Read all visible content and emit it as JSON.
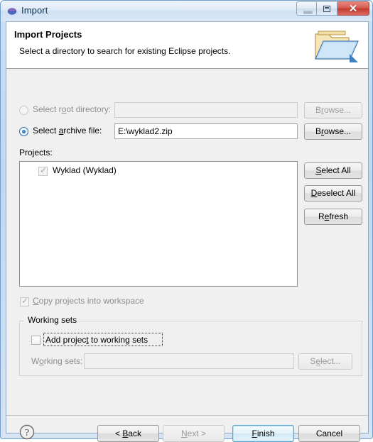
{
  "window": {
    "title": "Import",
    "icon": "eclipse-sphere-icon",
    "controls": {
      "minimize": "minimize-icon",
      "maximize": "restore-icon",
      "close": "close-icon",
      "close_glyph": "✕"
    }
  },
  "header": {
    "title": "Import Projects",
    "subtitle": "Select a directory to search for existing Eclipse projects.",
    "icon": "open-folder-icon"
  },
  "source": {
    "root_directory": {
      "label_pre": "Select r",
      "label_mnemonic": "o",
      "label_post": "ot directory:",
      "selected": false,
      "enabled": false,
      "value": "",
      "browse_label_pre": "B",
      "browse_mnemonic": "r",
      "browse_label_post": "owse...",
      "browse_enabled": false
    },
    "archive_file": {
      "label_pre": "Select ",
      "label_mnemonic": "a",
      "label_post": "rchive file:",
      "selected": true,
      "enabled": true,
      "value": "E:\\wyklad2.zip",
      "browse_label_pre": "B",
      "browse_mnemonic": "r",
      "browse_label_post": "owse...",
      "browse_enabled": true
    }
  },
  "projects": {
    "label": "Projects:",
    "items": [
      {
        "label": "Wyklad (Wyklad)",
        "checked": true
      }
    ],
    "buttons": {
      "select_all": {
        "pre": "",
        "mnemonic": "S",
        "post": "elect All"
      },
      "deselect_all": {
        "pre": "",
        "mnemonic": "D",
        "post": "eselect All"
      },
      "refresh": {
        "pre": "R",
        "mnemonic": "e",
        "post": "fresh"
      }
    }
  },
  "options": {
    "copy_projects": {
      "pre": "",
      "mnemonic": "C",
      "post": "opy projects into workspace",
      "checked": true,
      "enabled": false
    }
  },
  "working_sets": {
    "group_title": "Working sets",
    "add_checkbox": {
      "pre": "Add projec",
      "mnemonic": "t",
      "post": " to working sets",
      "checked": false,
      "focused": true
    },
    "combo_label_pre": "W",
    "combo_label_mnemonic": "o",
    "combo_label_post": "rking sets:",
    "combo_value": "",
    "combo_enabled": false,
    "select_button": {
      "pre": "S",
      "mnemonic": "e",
      "post": "lect...",
      "enabled": false
    }
  },
  "footer": {
    "help_icon": "help-question-icon",
    "back": {
      "pre": "< ",
      "mnemonic": "B",
      "post": "ack",
      "enabled": true
    },
    "next": {
      "pre": "",
      "mnemonic": "N",
      "post": "ext >",
      "enabled": false
    },
    "finish": {
      "pre": "",
      "mnemonic": "F",
      "post": "inish",
      "enabled": true,
      "default": true
    },
    "cancel": {
      "pre": "Cancel",
      "mnemonic": "",
      "post": "",
      "enabled": true
    }
  },
  "colors": {
    "dialog_bg": "#f0f0f0",
    "header_bg": "#ffffff",
    "accent_blue": "#1b6fb4",
    "default_button_border": "#5ba7cf",
    "close_red": "#c33a2f"
  }
}
